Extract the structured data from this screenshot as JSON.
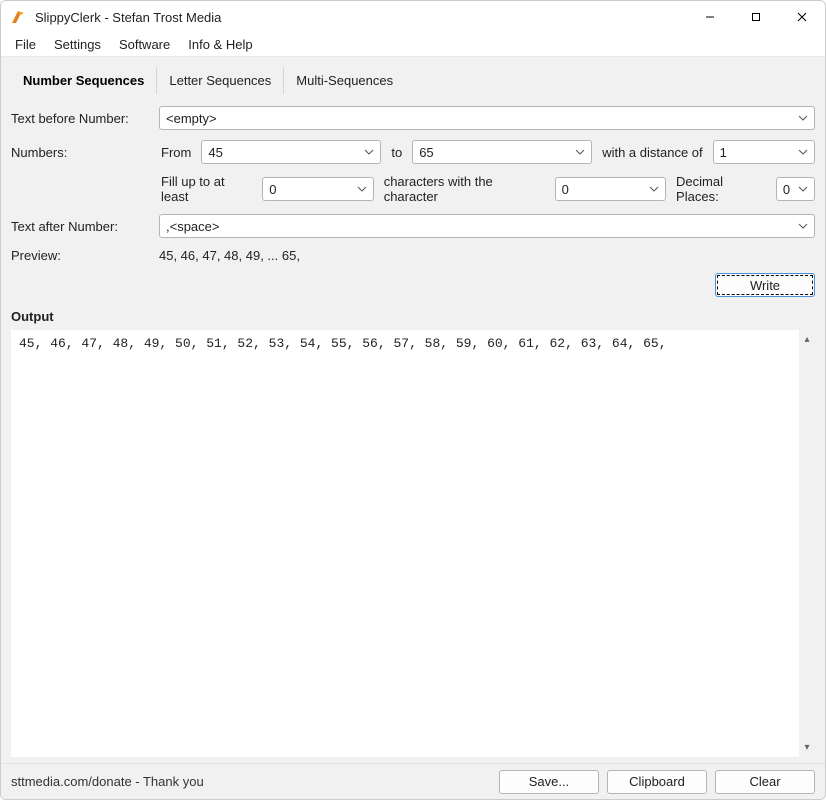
{
  "window": {
    "title": "SlippyClerk - Stefan Trost Media"
  },
  "menubar": [
    "File",
    "Settings",
    "Software",
    "Info & Help"
  ],
  "tabs": [
    {
      "label": "Number Sequences",
      "active": true
    },
    {
      "label": "Letter Sequences",
      "active": false
    },
    {
      "label": "Multi-Sequences",
      "active": false
    }
  ],
  "labels": {
    "text_before": "Text before Number:",
    "numbers": "Numbers:",
    "from": "From",
    "to": "to",
    "distance": "with a distance of",
    "fill_up": "Fill up to at least",
    "chars_with": "characters with the character",
    "decimal_places": "Decimal Places:",
    "text_after": "Text after Number:",
    "preview": "Preview:",
    "output": "Output"
  },
  "values": {
    "text_before": "<empty>",
    "from": "45",
    "to": "65",
    "distance": "1",
    "fill_up": "0",
    "fill_char": "0",
    "decimal_places": "0",
    "text_after": ",<space>",
    "preview": "45, 46, 47, 48, 49, ... 65,",
    "output": "45, 46, 47, 48, 49, 50, 51, 52, 53, 54, 55, 56, 57, 58, 59, 60, 61, 62, 63, 64, 65, "
  },
  "buttons": {
    "write": "Write",
    "save": "Save...",
    "clipboard": "Clipboard",
    "clear": "Clear"
  },
  "statusbar": {
    "text": "sttmedia.com/donate - Thank you"
  }
}
